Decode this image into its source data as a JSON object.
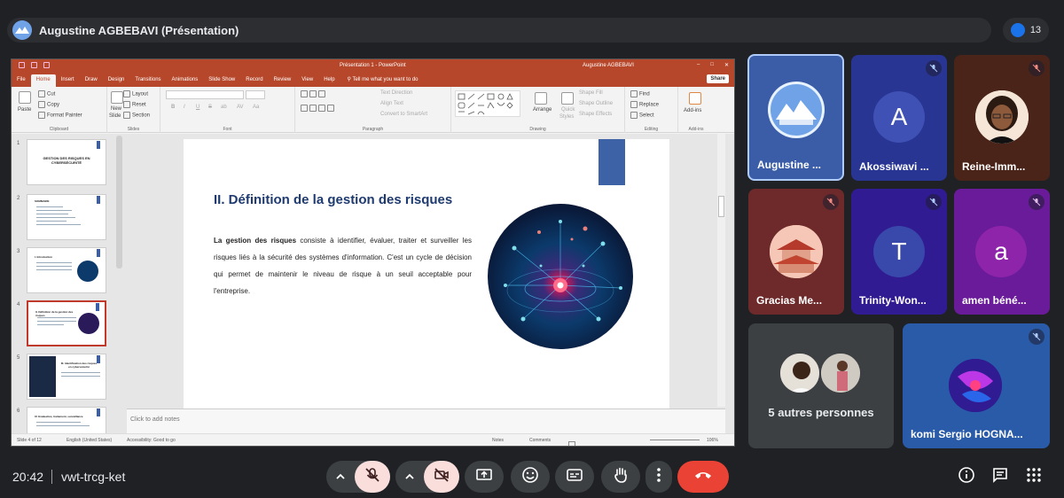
{
  "meet": {
    "presenter_label": "Augustine AGBEBAVI (Présentation)",
    "participant_count": "13",
    "time": "20:42",
    "meeting_code": "vwt-trcg-ket"
  },
  "ppt": {
    "window_title": "Présentation 1 - PowerPoint",
    "account": "Augustine AGBEBAVI",
    "tabs": [
      "File",
      "Home",
      "Insert",
      "Draw",
      "Design",
      "Transitions",
      "Animations",
      "Slide Show",
      "Record",
      "Review",
      "View",
      "Help"
    ],
    "tell_me": "Tell me what you want to do",
    "share": "Share",
    "ribbon": {
      "clipboard": {
        "label": "Clipboard",
        "paste": "Paste",
        "cut": "Cut",
        "copy": "Copy",
        "format_painter": "Format Painter"
      },
      "slides": {
        "label": "Slides",
        "new_slide_1": "New",
        "new_slide_2": "Slide",
        "layout": "Layout",
        "reset": "Reset",
        "section": "Section"
      },
      "font": {
        "label": "Font",
        "bold": "B",
        "italic": "I",
        "underline": "U",
        "strike": "S",
        "shadow": "ab",
        "spacing": "AV",
        "case": "Aa"
      },
      "paragraph": {
        "label": "Paragraph",
        "text_direction": "Text Direction",
        "align_text": "Align Text",
        "convert_smartart": "Convert to SmartArt"
      },
      "drawing": {
        "label": "Drawing",
        "arrange": "Arrange",
        "quick_styles_1": "Quick",
        "quick_styles_2": "Styles",
        "shape_fill": "Shape Fill",
        "shape_outline": "Shape Outline",
        "shape_effects": "Shape Effects"
      },
      "editing": {
        "label": "Editing",
        "find": "Find",
        "replace": "Replace",
        "select": "Select"
      },
      "addins": {
        "label": "Add-ins",
        "addins": "Add-ins"
      }
    },
    "thumbnails": [
      {
        "num": "1",
        "title": "GESTION DES RISQUES EN CYBERSÉCURITÉ"
      },
      {
        "num": "2",
        "title": "SOMMAIRE"
      },
      {
        "num": "3",
        "title": "I. Introduction"
      },
      {
        "num": "4",
        "title": "II. Définition de la gestion des risques"
      },
      {
        "num": "5",
        "title": "III. Identification des risques en cybersécurité"
      },
      {
        "num": "6",
        "title": "IV. Evaluation, traitement, surveillance"
      }
    ],
    "slide": {
      "title": "II.   Définition de la gestion des risques",
      "text_bold": "La gestion des risques",
      "text_rest": " consiste à identifier, évaluer, traiter et surveiller les risques liés à la sécurité des systèmes d'information. C'est un cycle de décision qui permet de maintenir le niveau de risque à un seuil acceptable pour l'entreprise."
    },
    "notes_placeholder": "Click to add notes",
    "status": {
      "slide_of": "Slide 4 of 12",
      "language": "English (United States)",
      "accessibility": "Accessibility: Good to go",
      "notes": "Notes",
      "comments": "Comments",
      "zoom": "106%"
    }
  },
  "participants": [
    {
      "name": "Augustine ...",
      "avatar": "photo",
      "muted": false
    },
    {
      "name": "Akossiwavi ...",
      "letter": "A",
      "color": "#3f51b5",
      "muted": true
    },
    {
      "name": "Reine-Imm...",
      "avatar": "photo",
      "muted": true
    },
    {
      "name": "Gracias Me...",
      "avatar": "photo",
      "muted": true
    },
    {
      "name": "Trinity-Won...",
      "letter": "T",
      "color": "#3949ab",
      "muted": true
    },
    {
      "name": "amen béné...",
      "letter": "a",
      "color": "#8e24aa",
      "muted": true
    },
    {
      "name": "5 autres personnes",
      "avatar": "group",
      "muted": false
    },
    {
      "name": "komi Sergio HOGNA...",
      "avatar": "photo",
      "muted": true
    }
  ],
  "colors": {
    "meet_bg": "#202124",
    "ppt_accent": "#b7472a",
    "end_call": "#ea4335",
    "muted_btn": "#f9dedc"
  }
}
